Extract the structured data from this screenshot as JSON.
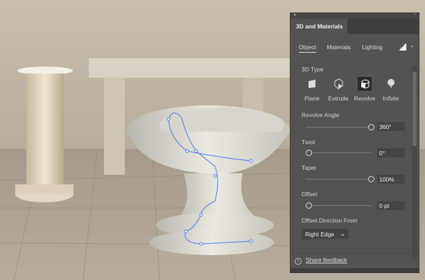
{
  "panel": {
    "title": "3D and Materials",
    "tabs": [
      {
        "label": "Object",
        "active": true
      },
      {
        "label": "Materials"
      },
      {
        "label": "Lighting"
      }
    ],
    "type_section": "3D Type",
    "types": [
      {
        "label": "Plane",
        "icon": "plane-icon"
      },
      {
        "label": "Extrude",
        "icon": "extrude-icon"
      },
      {
        "label": "Revolve",
        "icon": "revolve-icon",
        "selected": true
      },
      {
        "label": "Inflate",
        "icon": "inflate-icon"
      }
    ],
    "revolve_angle": {
      "label": "Revolve Angle",
      "value": "360°",
      "fraction": 1.0
    },
    "twist": {
      "label": "Twist",
      "value": "0°",
      "fraction": 0
    },
    "taper": {
      "label": "Taper",
      "value": "100%",
      "fraction": 1.0
    },
    "offset": {
      "label": "Offset",
      "value": "0 pt",
      "fraction": 0
    },
    "offset_direction": {
      "label": "Offset Direction From",
      "value": "Right Edge"
    },
    "share_feedback": "Share feedback",
    "close_icon": "×",
    "chevron": "⌄"
  },
  "colors": {
    "panel_bg": "#535353",
    "path_accent": "#4a7cf0"
  }
}
